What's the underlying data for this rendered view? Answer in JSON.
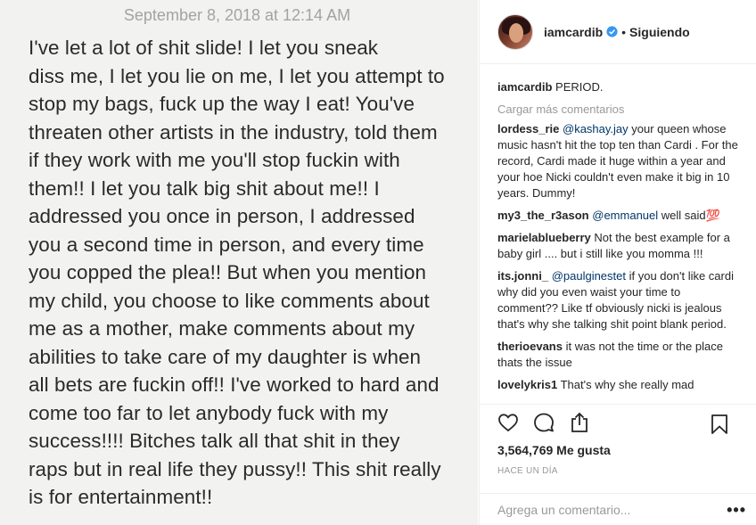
{
  "note": {
    "date": "September 8, 2018 at 12:14 AM",
    "lines": [
      "I've let a lot of shit slide! I let you sneak",
      "diss me, I let you lie on me, I let you attempt to",
      "stop my bags, fuck up the way I eat! You've",
      "threaten other artists in the industry, told them",
      "if they work with me you'll stop fuckin with",
      "them!! I let you talk big shit about me!! I",
      "addressed you once in person, I addressed",
      "you a second time in person, and every time",
      "you copped the plea!! But when you mention",
      "my child, you choose to like comments about",
      "me as a mother, make comments about my",
      "abilities to take care of my daughter is when",
      "all bets are fuckin off!! I've worked to hard and",
      "come too far to let anybody fuck with my",
      "success!!!! Bitches talk all that shit in they",
      "raps but in real life they pussy!! This shit really",
      "is for entertainment!!"
    ]
  },
  "header": {
    "username": "iamcardib",
    "separator": "•",
    "follow_status": "Siguiendo"
  },
  "caption": {
    "user": "iamcardib",
    "text": "PERIOD."
  },
  "load_more": "Cargar más comentarios",
  "comments": [
    {
      "user": "lordess_rie",
      "mention": "@kashay.jay",
      "text": " your queen whose music hasn't hit the top ten than Cardi . For the record, Cardi made it huge within a year and your hoe Nicki couldn't even make it big in 10 years. Dummy!"
    },
    {
      "user": "my3_the_r3ason",
      "mention": "@emmanuel",
      "text": " well said💯"
    },
    {
      "user": "marielablueberry",
      "mention": "",
      "text": "Not the best example for a baby girl .... but i still like you momma !!!"
    },
    {
      "user": "its.jonni_",
      "mention": "@paulginestet",
      "text": " if you don't like cardi why did you even waist your time to comment?? Like tf obviously nicki is jealous that's why she talking shit point blank period."
    },
    {
      "user": "therioevans",
      "mention": "",
      "text": "it was not the time or the place thats the issue"
    },
    {
      "user": "lovelykris1",
      "mention": "",
      "text": "That's why she really mad"
    }
  ],
  "likes": "3,564,769 Me gusta",
  "time_ago": "HACE UN DÍA",
  "add_comment_placeholder": "Agrega un comentario...",
  "more_options": "•••",
  "icons": {
    "like": "heart-icon",
    "comment": "comment-icon",
    "share": "share-icon",
    "save": "bookmark-icon",
    "verified": "verified-badge-icon"
  },
  "colors": {
    "text": "#262626",
    "muted": "#999999",
    "mention": "#003569",
    "verified": "#3897f0"
  }
}
